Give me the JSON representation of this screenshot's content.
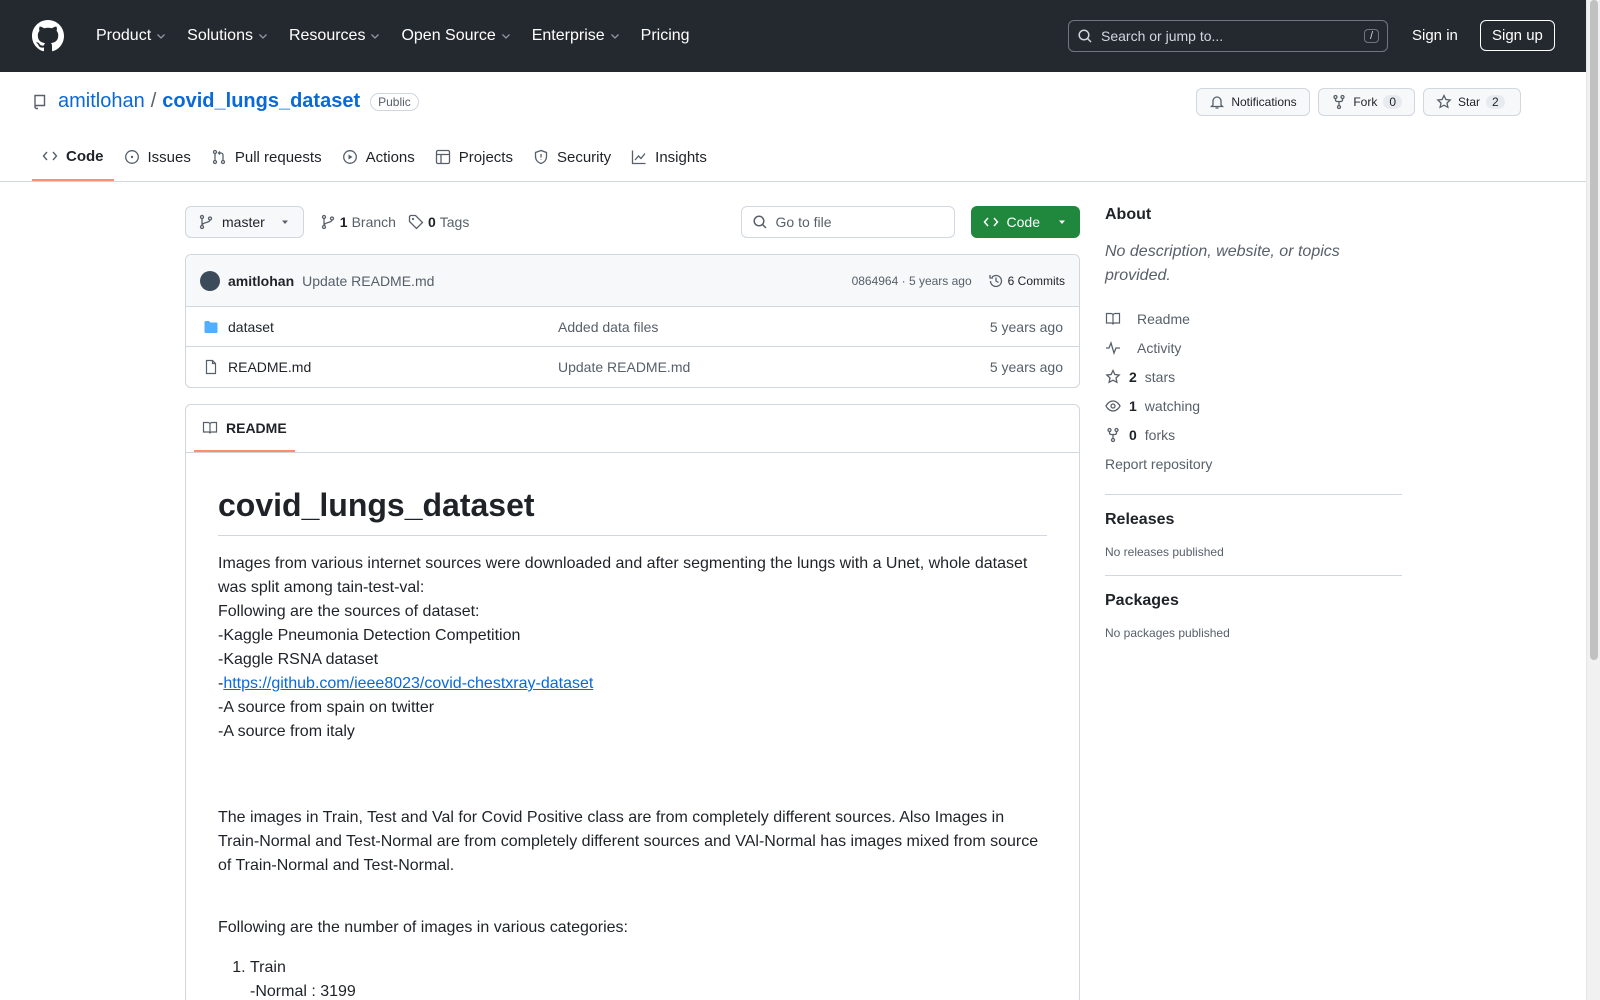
{
  "header": {
    "nav": [
      {
        "label": "Product",
        "dropdown": true
      },
      {
        "label": "Solutions",
        "dropdown": true
      },
      {
        "label": "Resources",
        "dropdown": true
      },
      {
        "label": "Open Source",
        "dropdown": true
      },
      {
        "label": "Enterprise",
        "dropdown": true
      },
      {
        "label": "Pricing",
        "dropdown": false
      }
    ],
    "search_placeholder": "Search or jump to...",
    "search_shortcut": "/",
    "sign_in": "Sign in",
    "sign_up": "Sign up"
  },
  "repo": {
    "owner": "amitlohan",
    "separator": "/",
    "name": "covid_lungs_dataset",
    "visibility": "Public",
    "notifications_label": "Notifications",
    "fork_label": "Fork",
    "fork_count": "0",
    "star_label": "Star",
    "star_count": "2"
  },
  "tabs": [
    {
      "label": "Code",
      "icon": "code-icon",
      "active": true
    },
    {
      "label": "Issues",
      "icon": "issue-icon",
      "active": false
    },
    {
      "label": "Pull requests",
      "icon": "pull-request-icon",
      "active": false
    },
    {
      "label": "Actions",
      "icon": "play-icon",
      "active": false
    },
    {
      "label": "Projects",
      "icon": "table-icon",
      "active": false
    },
    {
      "label": "Security",
      "icon": "shield-icon",
      "active": false
    },
    {
      "label": "Insights",
      "icon": "graph-icon",
      "active": false
    }
  ],
  "toolbar": {
    "branch": "master",
    "branch_count": "1",
    "branch_label": "Branch",
    "tag_count": "0",
    "tag_label": "Tags",
    "goto_placeholder": "Go to file",
    "code_button": "Code"
  },
  "commit": {
    "author": "amitlohan",
    "message": "Update README.md",
    "hash_and_age": "0864964 · 5 years ago",
    "commits": "6 Commits"
  },
  "files": [
    {
      "type": "folder",
      "name": "dataset",
      "message": "Added data files",
      "age": "5 years ago"
    },
    {
      "type": "file",
      "name": "README.md",
      "message": "Update README.md",
      "age": "5 years ago"
    }
  ],
  "readme": {
    "tab_label": "README",
    "title": "covid_lungs_dataset",
    "intro_lines": [
      "Images from various internet sources were downloaded and after segmenting the lungs with a Unet, whole dataset was split among tain-test-val:",
      "Following are the sources of dataset:",
      "-Kaggle Pneumonia Detection Competition",
      "-Kaggle RSNA dataset"
    ],
    "link_prefix": "-",
    "link_text": "https://github.com/ieee8023/covid-chestxray-dataset",
    "after_link_lines": [
      "-A source from spain on twitter",
      "-A source from italy"
    ],
    "para2": "The images in Train, Test and Val for Covid Positive class are from completely different sources. Also Images in Train-Normal and Test-Normal are from completely different sources and VAl-Normal has images mixed from source of Train-Normal and Test-Normal.",
    "para3": "Following are the number of images in various categories:",
    "list": [
      {
        "label": "Train",
        "sub": "-Normal : 3199"
      }
    ]
  },
  "about": {
    "title": "About",
    "description": "No description, website, or topics provided.",
    "links": [
      {
        "icon": "book-icon",
        "bold": "",
        "text": "Readme"
      },
      {
        "icon": "pulse-icon",
        "bold": "",
        "text": "Activity"
      },
      {
        "icon": "star-icon",
        "bold": "2",
        "text": "stars"
      },
      {
        "icon": "eye-icon",
        "bold": "1",
        "text": "watching"
      },
      {
        "icon": "fork-icon",
        "bold": "0",
        "text": "forks"
      }
    ],
    "report": "Report repository"
  },
  "releases": {
    "title": "Releases",
    "empty": "No releases published"
  },
  "packages": {
    "title": "Packages",
    "empty": "No packages published"
  }
}
